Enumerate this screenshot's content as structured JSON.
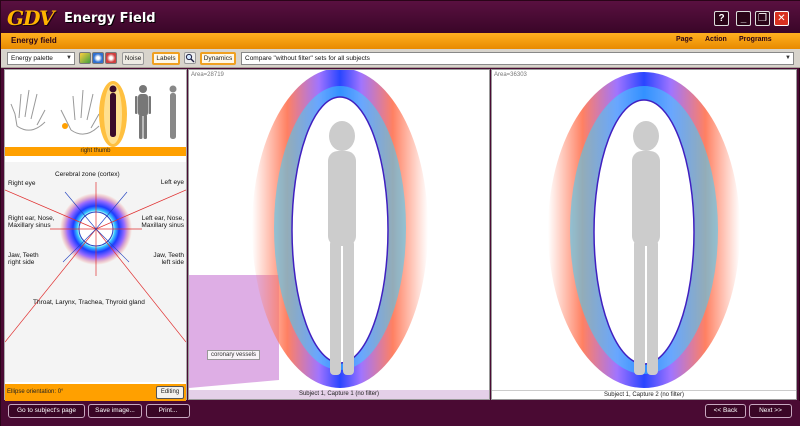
{
  "titlebar": {
    "logo": "GDV",
    "title": "Energy Field",
    "help_label": "?",
    "minimize_label": "_",
    "restore_label": "❐",
    "close_label": "✕"
  },
  "header": {
    "section_title": "Energy field",
    "menu": [
      "Page",
      "Action",
      "Programs"
    ]
  },
  "toolbar": {
    "palette_value": "Energy palette",
    "noise_label": "Noise",
    "labels_label": "Labels",
    "dynamics_label": "Dynamics",
    "compare_value": "Compare \"without filter\" sets for all subjects"
  },
  "left_panel": {
    "finger_caption": "right thumb",
    "zones": {
      "cerebral": "Cerebral zone (cortex)",
      "right_eye": "Right eye",
      "left_eye": "Left eye",
      "right_ear": "Right ear, Nose,\nMaxillary sinus",
      "left_ear": "Left ear, Nose,\nMaxillary sinus",
      "jaw_right": "Jaw, Teeth\nright side",
      "jaw_left": "Jaw, Teeth\nleft side",
      "throat": "Throat, Larynx, Trachea, Thyroid gland"
    },
    "ellipse_orientation": "Ellipse orientation: 0°",
    "editing_label": "Editing"
  },
  "panel1": {
    "area": "Area=28719",
    "tooltip": "coronary vessels",
    "caption": "Subject 1, Capture 1 (no filter)"
  },
  "panel2": {
    "area": "Area=36303",
    "caption": "Subject 1, Capture 2 (no filter)"
  },
  "bottom": {
    "go_subject": "Go to subject's page",
    "save_image": "Save image...",
    "print": "Print...",
    "back": "<< Back",
    "next": "Next >>"
  },
  "colors": {
    "accent": "#ffa000",
    "frame": "#4a0a33",
    "aura_outer": "#ff7a5a",
    "aura_mid": "#9b6dff",
    "aura_inner": "#1e3cff",
    "aura_core": "#3ad0ff"
  }
}
